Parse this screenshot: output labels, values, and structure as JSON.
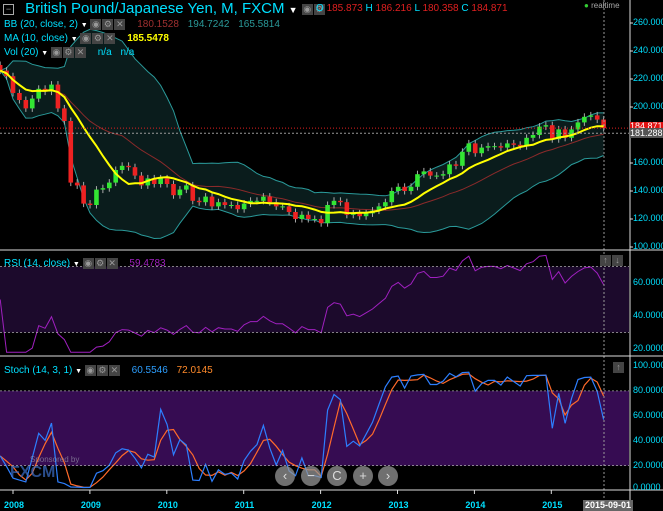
{
  "header": {
    "title": "British Pound/Japanese Yen, M, FXCM",
    "o_label": "O",
    "o": "185.873",
    "h_label": "H",
    "h": "186.216",
    "l_label": "L",
    "l": "180.358",
    "c_label": "C",
    "c": "184.871",
    "realtime": "realtime"
  },
  "indicators": {
    "bb": {
      "label": "BB (20, close, 2)",
      "v1": "180.1528",
      "v2": "194.7242",
      "v3": "165.5814"
    },
    "ma": {
      "label": "MA (10, close)",
      "v1": "185.5478"
    },
    "vol": {
      "label": "Vol (20)",
      "v1": "n/a",
      "v2": "n/a"
    },
    "rsi": {
      "label": "RSI (14, close)",
      "v1": "59.4783"
    },
    "stoch": {
      "label": "Stoch (14, 3, 1)",
      "v1": "60.5546",
      "v2": "72.0145"
    }
  },
  "price_tags": {
    "last": "184.871",
    "crosshair": "181.288"
  },
  "axes": {
    "price": [
      "260.000",
      "240.000",
      "220.000",
      "200.000",
      "180.000",
      "160.000",
      "140.000",
      "120.000",
      "100.000"
    ],
    "rsi": [
      "60.0000",
      "40.0000",
      "20.0000"
    ],
    "stoch": [
      "100.0000",
      "80.0000",
      "60.0000",
      "40.0000",
      "20.0000",
      "0.0000"
    ],
    "time": [
      "2008",
      "2009",
      "2010",
      "2011",
      "2012",
      "2013",
      "2014",
      "2015"
    ],
    "crosshair_date": "2015-09-01"
  },
  "sponsor": {
    "text": "Sponsored by",
    "brand": "FXCM"
  },
  "nav": [
    "‹",
    "−",
    "C",
    "+",
    "›"
  ],
  "colors": {
    "up": "#33e633",
    "down": "#ee2222",
    "ma": "#ffff00",
    "bb": "#2a9a9a",
    "bb_mid": "#8b2a2a",
    "rsi": "#a020c0",
    "stoch_k": "#2d7fff",
    "stoch_d": "#ff6a2a"
  },
  "chart_data": {
    "type": "candlestick",
    "title": "British Pound/Japanese Yen, M, FXCM",
    "start": "2007-11",
    "interval": "month",
    "closes": [
      226,
      222,
      210,
      205,
      199,
      206,
      213,
      211,
      216,
      199,
      190,
      146,
      144,
      131,
      130,
      141,
      142,
      146,
      155,
      158,
      157,
      151,
      144,
      149,
      145,
      149,
      145,
      137,
      141,
      144,
      133,
      132,
      136,
      129,
      132,
      130,
      130,
      127,
      131,
      133,
      133,
      136,
      132,
      129,
      129,
      125,
      120,
      123,
      120,
      120,
      117,
      130,
      133,
      132,
      123,
      124,
      122,
      124,
      126,
      129,
      132,
      140,
      143,
      140,
      143,
      152,
      154,
      151,
      151,
      152,
      159,
      158,
      168,
      174,
      167,
      171,
      172,
      172,
      171,
      174,
      173,
      172,
      178,
      180,
      186,
      187,
      177,
      184,
      178,
      184,
      189,
      193,
      194,
      191,
      184.871
    ],
    "ylim": [
      100,
      260
    ]
  }
}
